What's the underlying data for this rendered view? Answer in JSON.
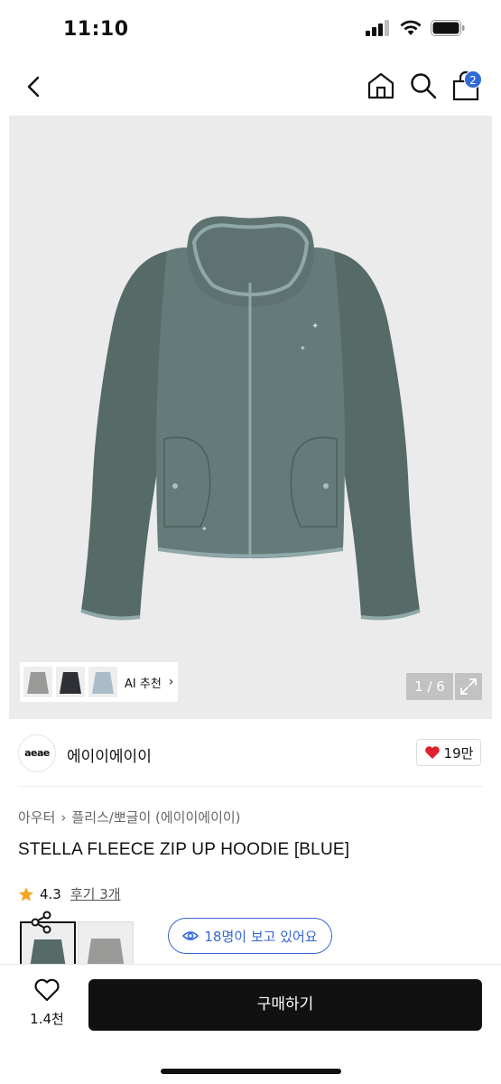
{
  "status": {
    "time": "11:10"
  },
  "nav": {
    "cart_count": "2"
  },
  "gallery": {
    "counter": "1 / 6",
    "ai_label": "AI 추천",
    "ai_chevron": "›"
  },
  "brand": {
    "logo_text": "aeae",
    "name": "에이이에이이",
    "likes": "19만"
  },
  "product": {
    "breadcrumb": [
      "아우터",
      "플리스/뽀글이 (에이이에이이)"
    ],
    "breadcrumb_sep": "›",
    "title": "STELLA FLEECE ZIP UP HOODIE [BLUE]",
    "rating": "4.3",
    "review_text": "후기 3개",
    "watching": "18명이 보고 있어요"
  },
  "bottom": {
    "wish_count": "1.4천",
    "buy_label": "구매하기"
  },
  "colors": {
    "accent_blue": "#3466d4",
    "badge_blue": "#2f6bd8",
    "heart_red": "#e0202e",
    "star": "#f5a623"
  }
}
